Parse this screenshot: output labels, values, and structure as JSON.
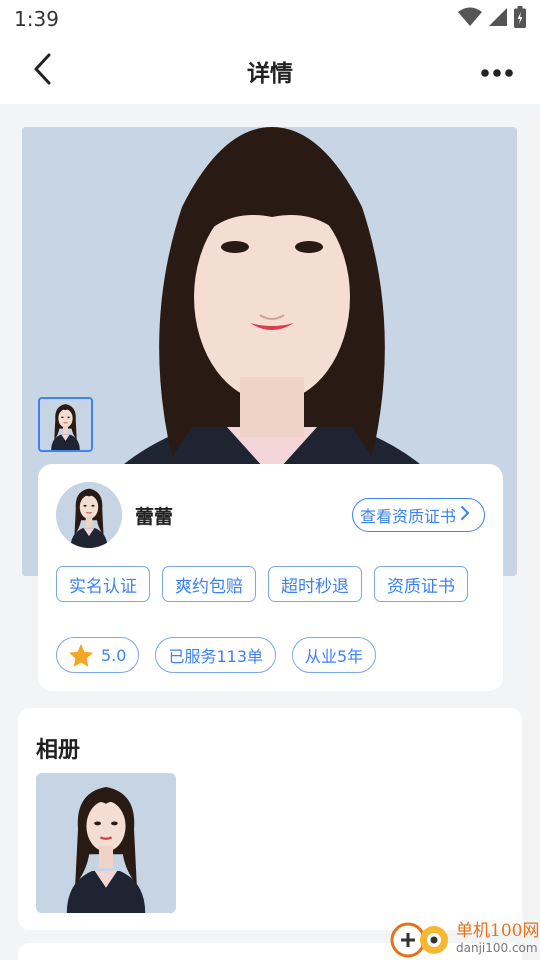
{
  "status_bar": {
    "time": "1:39"
  },
  "nav": {
    "title": "详情",
    "back_icon": "chevron-left-icon",
    "more_icon": "more-dots-icon"
  },
  "profile": {
    "name": "蕾蕾",
    "cert_link": "查看资质证书",
    "tags": [
      "实名认证",
      "爽约包赔",
      "超时秒退",
      "资质证书"
    ],
    "rating": "5.0",
    "served": "已服务113单",
    "experience": "从业5年"
  },
  "album": {
    "title": "相册"
  },
  "watermark": {
    "name": "单机100网",
    "url": "danji100.com"
  },
  "colors": {
    "accent": "#3b82f6",
    "star": "#f5a623",
    "background": "#f3f4f6",
    "photo_bg": "#c6d4e4"
  }
}
